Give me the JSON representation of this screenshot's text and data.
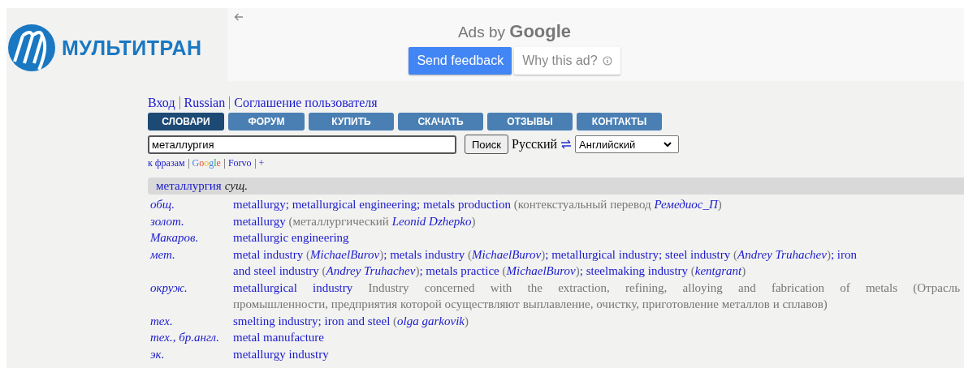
{
  "logo": {
    "text": "МУЛЬТИТРАН"
  },
  "ad": {
    "label": "Ads by **Google**",
    "buttons": [
      {
        "label": "Send feedback",
        "kind": "primary"
      },
      {
        "label": "Why this ad?",
        "kind": "info"
      }
    ]
  },
  "top_links": [
    "Вход",
    "Russian",
    "Соглашение пользователя"
  ],
  "tabs": [
    {
      "label": "СЛОВАРИ",
      "selected": true
    },
    {
      "label": "ФОРУМ",
      "selected": false
    },
    {
      "label": "КУПИТЬ",
      "selected": false
    },
    {
      "label": "СКАЧАТЬ",
      "selected": false
    },
    {
      "label": "ОТЗЫВЫ",
      "selected": false
    },
    {
      "label": "КОНТАКТЫ",
      "selected": false
    }
  ],
  "search": {
    "value": "металлургия",
    "button": "Поиск",
    "from_language": "Русский",
    "to_language": "Английский"
  },
  "extra_links": [
    {
      "text": "к фразам",
      "kind": "plain"
    },
    {
      "text": "Google",
      "kind": "google"
    },
    {
      "text": "Forvo",
      "kind": "plain"
    },
    {
      "text": "+",
      "kind": "plain"
    }
  ],
  "heading": {
    "word": "металлургия",
    "part_of_speech": "сущ."
  },
  "entries": [
    {
      "subject": "общ.",
      "lines": [
        {
          "justified": false,
          "segments": [
            {
              "kind": "term",
              "text": "metallurgy"
            },
            {
              "kind": "sep",
              "text": "; "
            },
            {
              "kind": "term",
              "text": "metallurgical engineering"
            },
            {
              "kind": "sep",
              "text": "; "
            },
            {
              "kind": "term",
              "text": "metals production"
            },
            {
              "kind": "note",
              "text": " (контекстуальный перевод "
            },
            {
              "kind": "author",
              "text": "Ремедиос_П"
            },
            {
              "kind": "note",
              "text": ")"
            }
          ]
        }
      ]
    },
    {
      "subject": "золот.",
      "lines": [
        {
          "justified": false,
          "segments": [
            {
              "kind": "term",
              "text": "metallurgy"
            },
            {
              "kind": "note",
              "text": " (металлургический "
            },
            {
              "kind": "author",
              "text": "Leonid Dzhepko"
            },
            {
              "kind": "note",
              "text": ")"
            }
          ]
        }
      ]
    },
    {
      "subject": "Макаров.",
      "lines": [
        {
          "justified": false,
          "segments": [
            {
              "kind": "term",
              "text": "metallurgic engineering"
            }
          ]
        }
      ]
    },
    {
      "subject": "мет.",
      "lines": [
        {
          "justified": false,
          "segments": [
            {
              "kind": "term",
              "text": "metal industry"
            },
            {
              "kind": "note",
              "text": " ("
            },
            {
              "kind": "author",
              "text": "MichaelBurov"
            },
            {
              "kind": "note",
              "text": ")"
            },
            {
              "kind": "sep",
              "text": "; "
            },
            {
              "kind": "term",
              "text": "metals industry"
            },
            {
              "kind": "note",
              "text": " ("
            },
            {
              "kind": "author",
              "text": "MichaelBurov"
            },
            {
              "kind": "note",
              "text": ")"
            },
            {
              "kind": "sep",
              "text": "; "
            },
            {
              "kind": "term",
              "text": "metallurgical industry"
            },
            {
              "kind": "sep",
              "text": "; "
            },
            {
              "kind": "term",
              "text": "steel industry"
            },
            {
              "kind": "note",
              "text": " ("
            },
            {
              "kind": "author",
              "text": "Andrey Truhachev"
            },
            {
              "kind": "note",
              "text": ")"
            },
            {
              "kind": "sep",
              "text": "; "
            },
            {
              "kind": "term",
              "text": "iron"
            }
          ]
        },
        {
          "justified": false,
          "segments": [
            {
              "kind": "term",
              "text": "and steel industry"
            },
            {
              "kind": "note",
              "text": " ("
            },
            {
              "kind": "author",
              "text": "Andrey Truhachev"
            },
            {
              "kind": "note",
              "text": ")"
            },
            {
              "kind": "sep",
              "text": "; "
            },
            {
              "kind": "term",
              "text": "metals practice"
            },
            {
              "kind": "note",
              "text": " ("
            },
            {
              "kind": "author",
              "text": "MichaelBurov"
            },
            {
              "kind": "note",
              "text": ")"
            },
            {
              "kind": "sep",
              "text": "; "
            },
            {
              "kind": "term",
              "text": "steelmaking industry"
            },
            {
              "kind": "note",
              "text": " ("
            },
            {
              "kind": "author",
              "text": "kentgrant"
            },
            {
              "kind": "note",
              "text": ")"
            }
          ]
        }
      ]
    },
    {
      "subject": "окруж.",
      "lines": [
        {
          "justified": true,
          "segments": [
            {
              "kind": "term",
              "text": "metallurgical industry"
            },
            {
              "kind": "note",
              "text": " Industry concerned with the extraction, refining, alloying and fabrication of metals (Отрасль"
            }
          ]
        },
        {
          "justified": false,
          "segments": [
            {
              "kind": "note",
              "text": "промышленности, предприятия которой осуществляют выплавление, очистку, приготовление металлов и сплавов)"
            }
          ]
        }
      ]
    },
    {
      "subject": "тех.",
      "lines": [
        {
          "justified": false,
          "segments": [
            {
              "kind": "term",
              "text": "smelting industry"
            },
            {
              "kind": "sep",
              "text": "; "
            },
            {
              "kind": "term",
              "text": "iron and steel"
            },
            {
              "kind": "note",
              "text": " ("
            },
            {
              "kind": "author",
              "text": "olga garkovik"
            },
            {
              "kind": "note",
              "text": ")"
            }
          ]
        }
      ]
    },
    {
      "subject": "тех., бр.англ.",
      "lines": [
        {
          "justified": false,
          "segments": [
            {
              "kind": "term",
              "text": "metal manufacture"
            }
          ]
        }
      ]
    },
    {
      "subject": "эк.",
      "lines": [
        {
          "justified": false,
          "segments": [
            {
              "kind": "term",
              "text": "metallurgy industry"
            }
          ]
        }
      ]
    }
  ]
}
